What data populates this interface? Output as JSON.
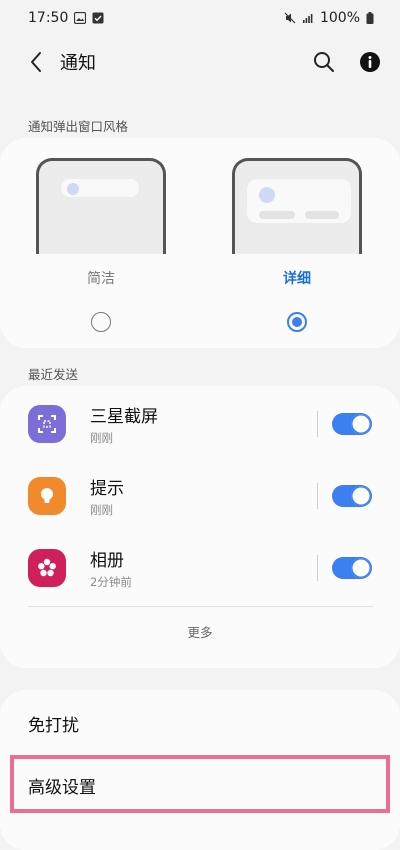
{
  "status_bar": {
    "time": "17:50",
    "battery": "100%"
  },
  "header": {
    "title": "通知",
    "icons": [
      "back-icon",
      "search-icon",
      "info-icon"
    ]
  },
  "popup_style": {
    "section_label": "通知弹出窗口风格",
    "options": [
      {
        "label": "简洁",
        "selected": false
      },
      {
        "label": "详细",
        "selected": true
      }
    ]
  },
  "recent": {
    "section_label": "最近发送",
    "apps": [
      {
        "name": "三星截屏",
        "time": "刚刚",
        "enabled": true,
        "icon": "screenshot-icon",
        "color": "#7b6ed6"
      },
      {
        "name": "提示",
        "time": "刚刚",
        "enabled": true,
        "icon": "bulb-icon",
        "color": "#f18a2a"
      },
      {
        "name": "相册",
        "time": "2分钟前",
        "enabled": true,
        "icon": "gallery-icon",
        "color": "#d0205b"
      }
    ],
    "more_label": "更多"
  },
  "settings": {
    "items": [
      {
        "label": "免打扰"
      },
      {
        "label": "高级设置"
      }
    ]
  },
  "colors": {
    "accent": "#3b7ff0",
    "highlight": "#ea6d93"
  }
}
